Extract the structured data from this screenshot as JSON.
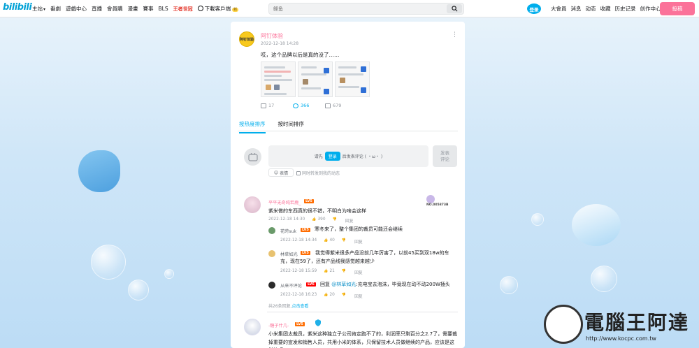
{
  "header": {
    "logo": "bilibili",
    "nav": [
      "主站",
      "番劇",
      "遊戲中心",
      "直播",
      "會員購",
      "漫畫",
      "賽事",
      "BLS"
    ],
    "game_label": "王者世冠",
    "download_label": "下載客戶端",
    "download_badge": "新",
    "search_placeholder": "鲣鱼",
    "login_label": "登录",
    "right_nav": [
      "大會員",
      "消息",
      "动态",
      "收藏",
      "历史记录",
      "创作中心"
    ],
    "post_label": "投稿"
  },
  "post": {
    "author": "阿钉体验",
    "avatar_text": "阿钉体验",
    "time": "2022-12-18 14:28",
    "text": "哎，这个品牌以后是真的没了……",
    "stats": {
      "repost": "17",
      "comment": "366",
      "like": "679"
    }
  },
  "tabs": {
    "hot": "按热度排序",
    "time": "按时间排序"
  },
  "comment_box": {
    "prefix": "请先",
    "login": "登录",
    "suffix": "后发表评论 ( ・ω・ )",
    "send": "发表\n评论",
    "emoji": "表情",
    "repost": "同时转发到我的动态"
  },
  "replies": [
    {
      "user": "平平无奇纯若鹿_",
      "level": "LV5",
      "text": "紫米做的东西真的很不错，不明白为啥会这样",
      "time": "2022-12-18 14:30",
      "likes": "390",
      "reply_label": "回复",
      "badge": "NO.005873B",
      "sub": [
        {
          "user": "花莳suk",
          "level": "LV5",
          "text": "寒冬来了，整个集团的裁员可能还会继续",
          "time": "2022-12-18 14:34",
          "likes": "40",
          "reply_label": "回复"
        },
        {
          "user": "林草如光",
          "level": "LV5",
          "text": "我觉得紫米很多产品没前几年厉害了，以前45买到双18w的车充，现在59了，还有产品线我感觉越来越少",
          "time": "2022-12-18 15:59",
          "likes": "21",
          "reply_label": "回复"
        },
        {
          "user": "从来不评论",
          "level": "LV6",
          "text_prefix": "回复",
          "mention": "@林草如光",
          "text": ":充电宝去泡沫，毕竟现在动不动200W插头",
          "time": "2022-12-18 16:23",
          "likes": "20",
          "reply_label": "回复"
        }
      ],
      "more_prefix": "共26条回复,",
      "more_link": "点击查看"
    },
    {
      "user": "-糖子什几-",
      "level": "LV5",
      "text": "小米集团太裁员，紫米这种独立子公司肯定跑不了的，利润率只剩百分之2.7了，需要裁掉重要的宣发和销售人员，共用小米的体系，只保留技术人员做继续的产品，应该是这样的吧"
    }
  ],
  "watermark": {
    "title": "電腦王阿達",
    "url": "http://www.kocpc.com.tw"
  },
  "colors": {
    "accent": "#00aeec",
    "pink": "#fb7299",
    "background_top": "#eaf4fb",
    "background_bottom": "#bcdcf5"
  }
}
